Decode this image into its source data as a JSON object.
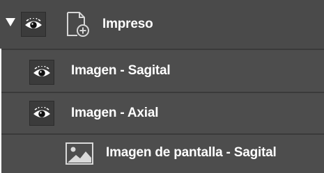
{
  "tree": {
    "group": {
      "label": "Impreso",
      "expanded": true,
      "icon": "document-add-icon",
      "visibility_icon": "eye-icon"
    },
    "items": [
      {
        "label": "Imagen - Sagital",
        "visibility_icon": "eye-icon"
      },
      {
        "label": "Imagen - Axial",
        "visibility_icon": "eye-icon"
      },
      {
        "label": "Imagen de pantalla - Sagital",
        "icon": "image-icon"
      }
    ]
  },
  "colors": {
    "header_bg": "#4a4a4a",
    "row_bg": "#4d4d4d",
    "eye_button_bg": "#3b3b3b",
    "text": "#ffffff"
  }
}
